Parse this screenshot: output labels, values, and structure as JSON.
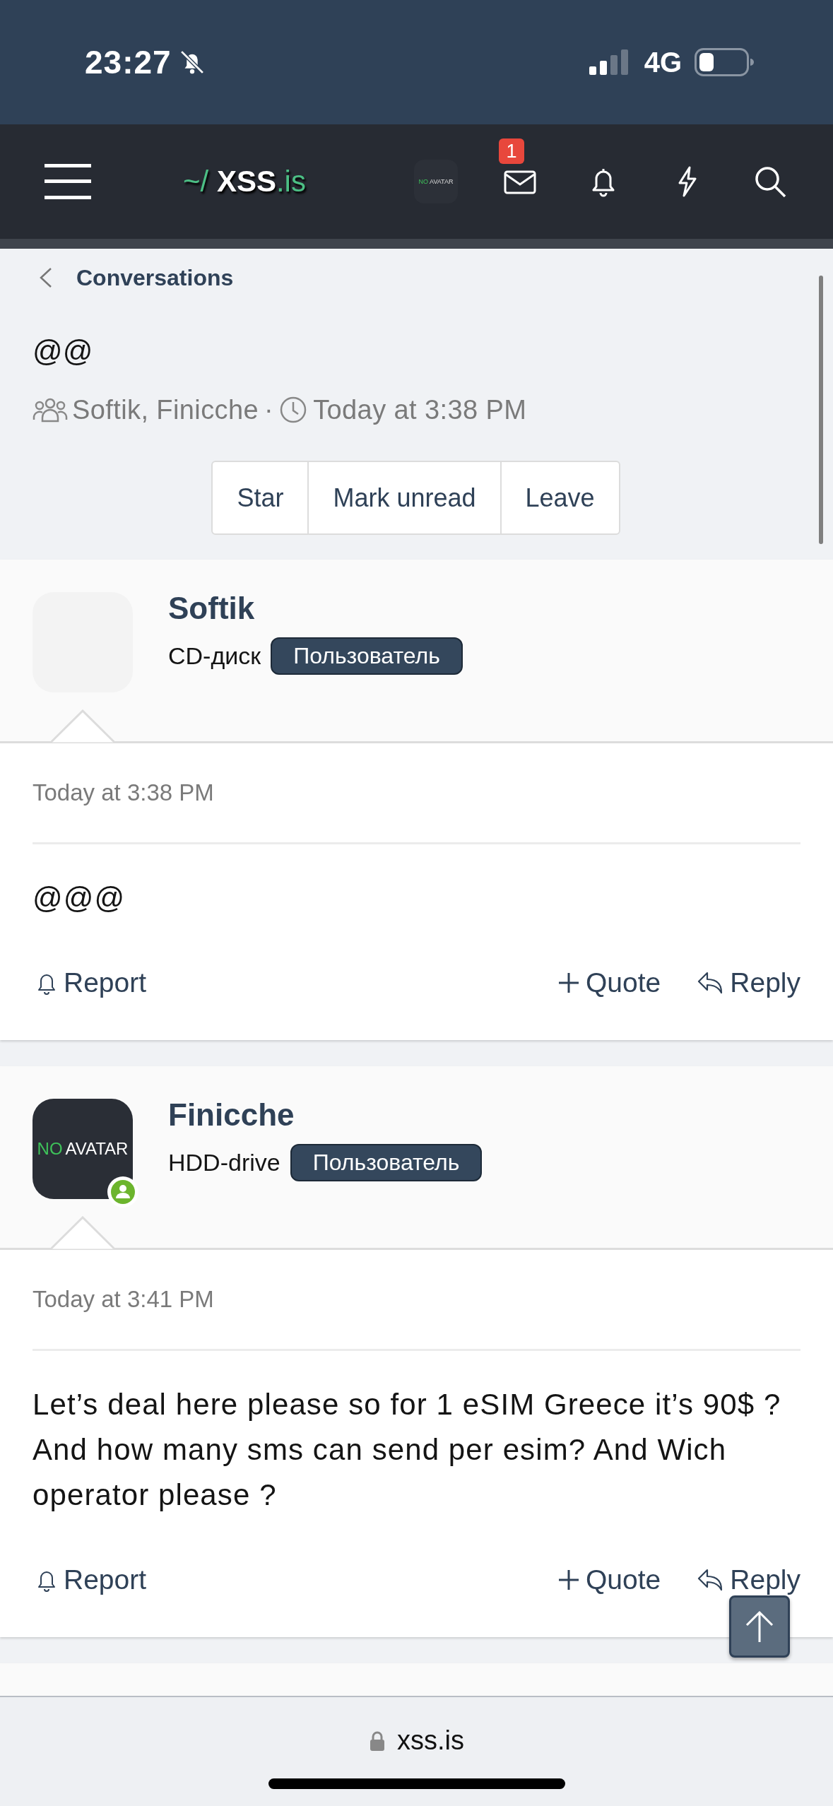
{
  "status_bar": {
    "time": "23:27",
    "silent": true,
    "network": "4G"
  },
  "nav": {
    "logo": {
      "prefix": "~/",
      "name": "XSS",
      "suffix": ".is"
    },
    "avatar": {
      "kind": "placeholder",
      "prefix": "NO",
      "label": "AVATAR"
    },
    "inbox_badge": "1"
  },
  "breadcrumb": "Conversations",
  "conversation": {
    "title": "@@",
    "participants": "Softik, Finicche",
    "separator": "·",
    "time": "Today at 3:38 PM"
  },
  "actions": [
    "Star",
    "Mark unread",
    "Leave"
  ],
  "messages": [
    {
      "author": "Softik",
      "avatar": {
        "kind": "blank"
      },
      "online": false,
      "rank": "CD-диск",
      "role": "Пользователь",
      "time": "Today at 3:38 PM",
      "body": "@@@",
      "actions": [
        {
          "kind": "report",
          "label": "Report"
        },
        {
          "kind": "quote",
          "label": "Quote"
        },
        {
          "kind": "reply",
          "label": "Reply"
        }
      ]
    },
    {
      "author": "Finicche",
      "avatar": {
        "kind": "placeholder",
        "prefix": "NO",
        "label": "AVATAR"
      },
      "online": true,
      "rank": "HDD-drive",
      "role": "Пользователь",
      "time": "Today at 3:41 PM",
      "body": "Let’s deal here please so for 1 eSIM Greece it’s 90$ ? And how many sms can send per esim? And Wich operator please ?",
      "actions": [
        {
          "kind": "report",
          "label": "Report"
        },
        {
          "kind": "quote",
          "label": "Quote"
        },
        {
          "kind": "reply",
          "label": "Reply"
        }
      ]
    }
  ],
  "browser": {
    "url": "xss.is",
    "secure": true
  }
}
